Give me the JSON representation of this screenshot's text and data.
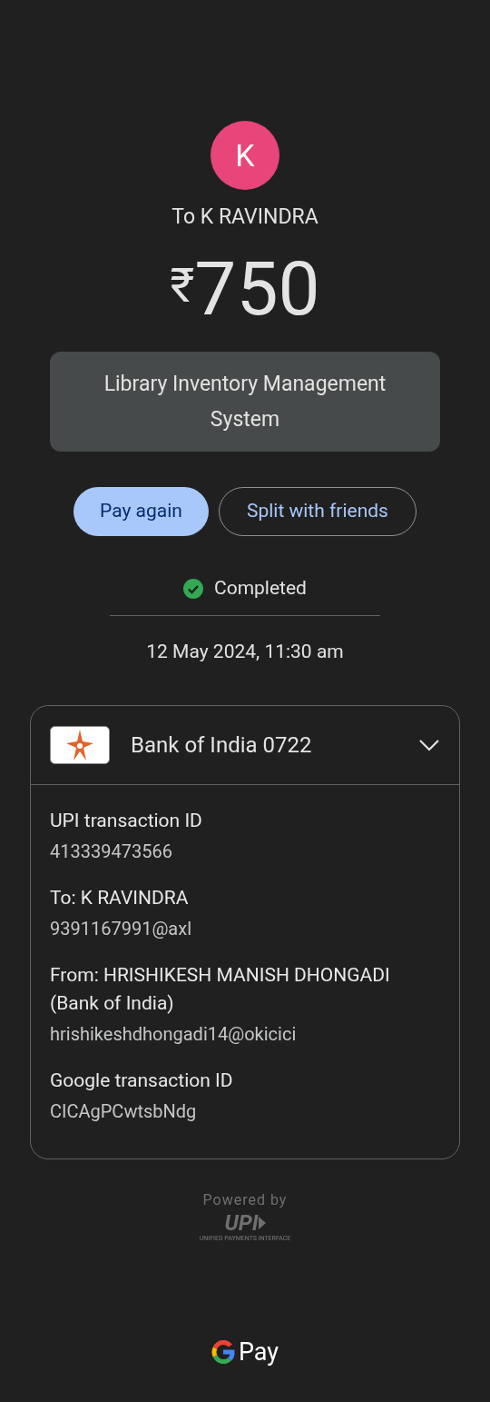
{
  "recipient": {
    "initial": "K",
    "color": "#e8457a",
    "label": "To K RAVINDRA"
  },
  "amount": {
    "currency": "₹",
    "value": "750"
  },
  "note": "Library Inventory Management System",
  "buttons": [
    {
      "label": "Pay again",
      "kind": "primary"
    },
    {
      "label": "Split with friends",
      "kind": "outline"
    }
  ],
  "status": {
    "label": "Completed",
    "completed": true
  },
  "date": "12 May 2024, 11:30 am",
  "account": {
    "name": "Bank of India 0722",
    "expanded": false
  },
  "details": [
    {
      "label": "UPI transaction ID",
      "value": "413339473566"
    },
    {
      "label": "To: K RAVINDRA",
      "value": "9391167991@axl"
    },
    {
      "label": "From: HRISHIKESH MANISH DHONGADI (Bank of India)",
      "value": "hrishikeshdhongadi14@okicici"
    },
    {
      "label": "Google transaction ID",
      "value": "CICAgPCwtsbNdg"
    }
  ],
  "footer": {
    "powered_by": "Powered by",
    "upi_logo": "UPI",
    "upi_tagline": "UNIFIED PAYMENTS INTERFACE",
    "brand": "Pay"
  }
}
